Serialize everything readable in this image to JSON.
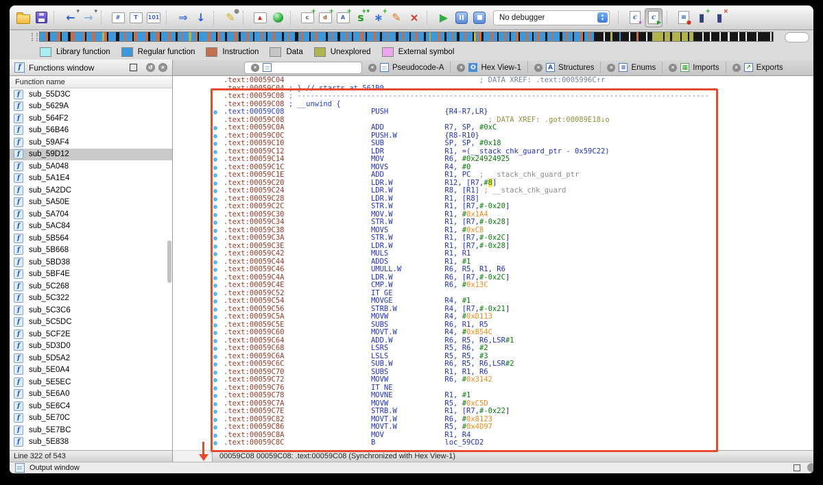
{
  "toolbar": {
    "debugger_label": "No debugger",
    "items": [
      {
        "n": "open-file-button",
        "k": "folder"
      },
      {
        "n": "save-file-button",
        "k": "floppy"
      },
      {
        "k": "sep"
      },
      {
        "n": "navigate-back-button",
        "k": "glyph",
        "g": "←",
        "c": "#2f5fd0",
        "b": "▾",
        "bc": "#666"
      },
      {
        "n": "navigate-forward-button",
        "k": "glyph",
        "g": "→",
        "c": "#8fb2e2",
        "b": "▾",
        "bc": "#666"
      },
      {
        "k": "sep"
      },
      {
        "n": "search-pattern-button",
        "k": "box",
        "g": "#",
        "c": "#3b62c8"
      },
      {
        "n": "search-text-button",
        "k": "box",
        "g": "T",
        "c": "#3b62c8"
      },
      {
        "n": "search-value-button",
        "k": "box",
        "g": "101",
        "c": "#3b62c8"
      },
      {
        "k": "sep"
      },
      {
        "n": "jump-button",
        "k": "glyph",
        "g": "⇒",
        "c": "#3b74d8"
      },
      {
        "n": "jump-next-button",
        "k": "glyph",
        "g": "↓",
        "c": "#2b62d0"
      },
      {
        "k": "sep"
      },
      {
        "n": "highlight-lock-button",
        "k": "glyph",
        "g": "✎",
        "c": "#d4b020",
        "b": "●",
        "bc": "#888"
      },
      {
        "k": "sep"
      },
      {
        "n": "problems-button",
        "k": "box",
        "g": "▲",
        "c": "#d93025"
      },
      {
        "n": "analysis-indicator",
        "k": "circle"
      },
      {
        "k": "sep"
      },
      {
        "n": "make-code-button",
        "k": "box",
        "g": "c",
        "c": "#555555",
        "b": "+",
        "bc": "#1f9f1f"
      },
      {
        "n": "make-data-button",
        "k": "box",
        "g": "d",
        "c": "#a0522d",
        "b": "+",
        "bc": "#1f9f1f"
      },
      {
        "n": "make-ascii-button",
        "k": "box",
        "g": "A",
        "c": "#3b62c8",
        "b": "+",
        "bc": "#1f9f1f"
      },
      {
        "n": "make-string-button",
        "k": "glyph",
        "g": "s",
        "c": "#1f9f1f",
        "b": "+▾",
        "bc": "#1f9f1f"
      },
      {
        "n": "make-array-button",
        "k": "glyph",
        "g": "∗",
        "c": "#3b74d8",
        "b": "+",
        "bc": "#1f9f1f"
      },
      {
        "n": "edit-button",
        "k": "glyph",
        "g": "✎",
        "c": "#e07820"
      },
      {
        "n": "undefine-button",
        "k": "glyph",
        "g": "×",
        "c": "#d43020"
      },
      {
        "k": "sep"
      },
      {
        "n": "start-process-button",
        "k": "glyph",
        "g": "▶",
        "c": "#2fae3f"
      },
      {
        "n": "pause-process-button",
        "k": "pause"
      },
      {
        "n": "stop-process-button",
        "k": "stop"
      },
      {
        "n": "debugger-select",
        "k": "combo"
      },
      {
        "k": "sep"
      },
      {
        "n": "compile-c-file-button",
        "k": "doc",
        "g": "c",
        "mark": "★",
        "mc": "#c050d0"
      },
      {
        "n": "pseudocode-button",
        "k": "doc",
        "g": "c",
        "mark": "▶",
        "mc": "#1f9f1f",
        "sel": true
      },
      {
        "k": "sep"
      },
      {
        "n": "notes-button",
        "k": "doc",
        "g": "≡",
        "mark": "●",
        "mc": "#d43020"
      },
      {
        "n": "add-breakpoint-button",
        "k": "glyph",
        "g": "▮",
        "c": "#35427e",
        "b": "+",
        "bc": "#1f9f1f"
      },
      {
        "n": "remove-breakpoint-button",
        "k": "glyph",
        "g": "▮",
        "c": "#35427e",
        "b": "×",
        "bc": "#d43020"
      }
    ]
  },
  "nav_band": {
    "marker_px": 633,
    "colors": {
      "K": "#161616",
      "B": "#3d97d8",
      "R": "#bf7150",
      "O": "#b2b24e",
      "G": "#c9c9c9",
      "W": "#f2f2f2"
    },
    "pattern": "8B 4R 3K 10B 5R 2K 9B 4K 6R 12B 3R 2K 8B 5R 10B 3O 4R 2K 11B 5K 7B 3R 9B 2K 5R 12B 4R 3K 8B 6R 2K 10B 4R 7B 3K 5B 2R 9B 4O 6B 3R 2K 12B 5R 8B 2K 4R 7B 3K 10B 5R 2B 3K 8B 4R 6B 2K 9B 3R 5B 2K 7B 4R 10B 3K 6B 2R 8B 5K 4B 3R 9B 2K 6B 4R 12B 3K 5B 2R 7B 4K 8B 3R 6B 2K 10B 5R 3B 2K 9B 4R 6B 3K 7B 2R 11B 4K 5B 3R 8B 2K 6B 4R 9B 3K 5B 2O 10B 4R 6B 3K 8B 2R 5B 4K 7B 3R 9B 2K 6B 5R 3K 10B 4R 6B 2K 8B 3R 5B 2K 7B 4R 2K 9B 3R 6B 2K 5B 4R 8B 3K 6B 2R 10B 4K 5B 3R 7B 2K 9B 4R 2K 6B 3R 5B 14K 2W 8K 3O 10K 2B 12K 2W 9K 3R 11K 2W 7K 16O 2K 8O 3K 12O 2K 9O 2K 6O 13K 2W 9K 2W 12K 2W 10K 3W 12K 2W 9K 2W 14K 2W 10K 8K 2W 4K"
  },
  "legend": {
    "items": [
      {
        "label": "Library function",
        "color": "#a8eef2"
      },
      {
        "label": "Regular function",
        "color": "#3d97d8"
      },
      {
        "label": "Instruction",
        "color": "#bf7150"
      },
      {
        "label": "Data",
        "color": "#c6c6c6"
      },
      {
        "label": "Unexplored",
        "color": "#b2b24e"
      },
      {
        "label": "External symbol",
        "color": "#eba6ec"
      }
    ]
  },
  "functions_panel": {
    "title": "Functions window",
    "column_header": "Function name",
    "status": "Line 322 of 543",
    "selected_index": 5,
    "items": [
      "sub_55D3C",
      "sub_5629A",
      "sub_564F2",
      "sub_56B46",
      "sub_59AF4",
      "sub_59D12",
      "sub_5A048",
      "sub_5A1E4",
      "sub_5A2DC",
      "sub_5A50E",
      "sub_5A704",
      "sub_5AC84",
      "sub_5B564",
      "sub_5B668",
      "sub_5BD38",
      "sub_5BF4E",
      "sub_5C268",
      "sub_5C322",
      "sub_5C3C6",
      "sub_5C5DC",
      "sub_5CF2E",
      "sub_5D3D0",
      "sub_5D5A2",
      "sub_5E0A4",
      "sub_5E5EC",
      "sub_5E6A0",
      "sub_5E6C4",
      "sub_5E70C",
      "sub_5E7BC",
      "sub_5E838"
    ]
  },
  "tabs": {
    "items": [
      {
        "name": "tab-ida-view",
        "label": "",
        "icon": "page",
        "active": true
      },
      {
        "name": "tab-pseudocode",
        "label": "Pseudocode-A",
        "icon": "page"
      },
      {
        "name": "tab-hex-view",
        "label": "Hex View-1",
        "icon": "hex",
        "glyph": "O"
      },
      {
        "name": "tab-structures",
        "label": "Structures",
        "icon": "struct",
        "glyph": "A"
      },
      {
        "name": "tab-enums",
        "label": "Enums",
        "icon": "enum",
        "glyph": "≡"
      },
      {
        "name": "tab-imports",
        "label": "Imports",
        "icon": "imp",
        "glyph": "▦"
      },
      {
        "name": "tab-exports",
        "label": "Exports",
        "icon": "exp",
        "glyph": "↗"
      }
    ]
  },
  "disassembly": {
    "status": "00059C08  00059C08: .text:00059C08  (Synchronized with Hex View-1)",
    "lines": [
      {
        "a": ".text:00059C04",
        "s": [
          [
            "                                             ",
            "p"
          ],
          [
            "; DATA XREF: .text:0005996C↑r",
            "xs"
          ]
        ]
      },
      {
        "a": ".text:00059C04",
        "s": [
          [
            " ; } // starts at 561B0",
            "c"
          ]
        ]
      },
      {
        "a": ".text:00059C08",
        "s": [
          [
            " ; -----------------------------------------------------------------------------------------------",
            "d"
          ]
        ]
      },
      {
        "a": ".text:00059C08",
        "s": [
          [
            " ; __unwind {",
            "c"
          ]
        ]
      },
      {
        "a": ".text:00059C08",
        "cur": true,
        "dot": true,
        "s": [
          [
            "                    PUSH             {R4-R7,LR}",
            "i"
          ]
        ]
      },
      {
        "a": ".text:00059C08",
        "s": [
          [
            "                                               ",
            "p"
          ],
          [
            "; DATA XREF: .got:00089E18↓o",
            "xo"
          ]
        ]
      },
      {
        "a": ".text:00059C0A",
        "dot": true,
        "s": [
          [
            "                    ADD              R7, SP, ",
            "i"
          ],
          [
            "#0xC",
            "g"
          ]
        ]
      },
      {
        "a": ".text:00059C0C",
        "dot": true,
        "s": [
          [
            "                    PUSH.W           {R8-R10}",
            "i"
          ]
        ]
      },
      {
        "a": ".text:00059C10",
        "dot": true,
        "s": [
          [
            "                    SUB              SP, SP, ",
            "i"
          ],
          [
            "#0x18",
            "g"
          ]
        ]
      },
      {
        "a": ".text:00059C12",
        "dot": true,
        "s": [
          [
            "                    LDR              R1, =(__stack_chk_guard_ptr - 0x59C22)",
            "i"
          ]
        ]
      },
      {
        "a": ".text:00059C14",
        "dot": true,
        "s": [
          [
            "                    MOV              R6, ",
            "i"
          ],
          [
            "#0x24924925",
            "g"
          ]
        ]
      },
      {
        "a": ".text:00059C1C",
        "dot": true,
        "s": [
          [
            "                    MOVS             R4, ",
            "i"
          ],
          [
            "#0",
            "g"
          ]
        ]
      },
      {
        "a": ".text:00059C1E",
        "dot": true,
        "s": [
          [
            "                    ADD              R1, PC  ",
            "i"
          ],
          [
            "; __stack_chk_guard_ptr",
            "n"
          ]
        ]
      },
      {
        "a": ".text:00059C20",
        "dot": true,
        "s": [
          [
            "                    LDR.W            R12, [R7,",
            "i"
          ],
          [
            "#",
            "g"
          ],
          [
            "8",
            "y"
          ],
          [
            "]",
            "i"
          ]
        ]
      },
      {
        "a": ".text:00059C24",
        "dot": true,
        "s": [
          [
            "                    LDR.W            R8, [R1] ",
            "i"
          ],
          [
            "; __stack_chk_guard",
            "n"
          ]
        ]
      },
      {
        "a": ".text:00059C28",
        "dot": true,
        "s": [
          [
            "                    LDR.W            R1, [R8]",
            "i"
          ]
        ]
      },
      {
        "a": ".text:00059C2C",
        "dot": true,
        "s": [
          [
            "                    STR.W            R1, [R7,",
            "i"
          ],
          [
            "#-0x20",
            "g"
          ],
          [
            "]",
            "i"
          ]
        ]
      },
      {
        "a": ".text:00059C30",
        "dot": true,
        "s": [
          [
            "                    MOV.W            R1, ",
            "i"
          ],
          [
            "#",
            "g"
          ],
          [
            "0x1A4",
            "o"
          ]
        ]
      },
      {
        "a": ".text:00059C34",
        "dot": true,
        "s": [
          [
            "                    STR.W            R1, [R7,",
            "i"
          ],
          [
            "#-0x28",
            "g"
          ],
          [
            "]",
            "i"
          ]
        ]
      },
      {
        "a": ".text:00059C38",
        "dot": true,
        "s": [
          [
            "                    MOVS             R1, ",
            "i"
          ],
          [
            "#",
            "g"
          ],
          [
            "0xC8",
            "o"
          ]
        ]
      },
      {
        "a": ".text:00059C3A",
        "dot": true,
        "s": [
          [
            "                    STR.W            R1, [R7,",
            "i"
          ],
          [
            "#-0x2C",
            "g"
          ],
          [
            "]",
            "i"
          ]
        ]
      },
      {
        "a": ".text:00059C3E",
        "dot": true,
        "s": [
          [
            "                    LDR.W            R1, [R7,",
            "i"
          ],
          [
            "#-0x28",
            "g"
          ],
          [
            "]",
            "i"
          ]
        ]
      },
      {
        "a": ".text:00059C42",
        "dot": true,
        "s": [
          [
            "                    MULS             R1, R1",
            "i"
          ]
        ]
      },
      {
        "a": ".text:00059C44",
        "dot": true,
        "s": [
          [
            "                    ADDS             R1, ",
            "i"
          ],
          [
            "#1",
            "g"
          ]
        ]
      },
      {
        "a": ".text:00059C46",
        "dot": true,
        "s": [
          [
            "                    UMULL.W          R6, R5, R1, R6",
            "i"
          ]
        ]
      },
      {
        "a": ".text:00059C4A",
        "dot": true,
        "s": [
          [
            "                    LDR.W            R6, [R7,",
            "i"
          ],
          [
            "#-0x2C",
            "g"
          ],
          [
            "]",
            "i"
          ]
        ]
      },
      {
        "a": ".text:00059C4E",
        "dot": true,
        "s": [
          [
            "                    CMP.W            R6, ",
            "i"
          ],
          [
            "#",
            "g"
          ],
          [
            "0x13C",
            "o"
          ]
        ]
      },
      {
        "a": ".text:00059C52",
        "dot": true,
        "s": [
          [
            "                    IT GE",
            "i"
          ]
        ]
      },
      {
        "a": ".text:00059C54",
        "dot": true,
        "s": [
          [
            "                    MOVGE            R4, ",
            "i"
          ],
          [
            "#1",
            "g"
          ]
        ]
      },
      {
        "a": ".text:00059C56",
        "dot": true,
        "s": [
          [
            "                    STRB.W           R4, [R7,",
            "i"
          ],
          [
            "#-0x21",
            "g"
          ],
          [
            "]",
            "i"
          ]
        ]
      },
      {
        "a": ".text:00059C5A",
        "dot": true,
        "s": [
          [
            "                    MOVW             R4, ",
            "i"
          ],
          [
            "#",
            "g"
          ],
          [
            "0xD113",
            "o"
          ]
        ]
      },
      {
        "a": ".text:00059C5E",
        "dot": true,
        "s": [
          [
            "                    SUBS             R6, R1, R5",
            "i"
          ]
        ]
      },
      {
        "a": ".text:00059C60",
        "dot": true,
        "s": [
          [
            "                    MOVT.W           R4, ",
            "i"
          ],
          [
            "#",
            "g"
          ],
          [
            "0xB54C",
            "o"
          ]
        ]
      },
      {
        "a": ".text:00059C64",
        "dot": true,
        "s": [
          [
            "                    ADD.W            R6, R5, R6,LSR",
            "i"
          ],
          [
            "#1",
            "g"
          ]
        ]
      },
      {
        "a": ".text:00059C68",
        "dot": true,
        "s": [
          [
            "                    LSRS             R5, R6, ",
            "i"
          ],
          [
            "#2",
            "g"
          ]
        ]
      },
      {
        "a": ".text:00059C6A",
        "dot": true,
        "s": [
          [
            "                    LSLS             R5, R5, ",
            "i"
          ],
          [
            "#3",
            "g"
          ]
        ]
      },
      {
        "a": ".text:00059C6C",
        "dot": true,
        "s": [
          [
            "                    SUB.W            R6, R5, R6,LSR",
            "i"
          ],
          [
            "#2",
            "g"
          ]
        ]
      },
      {
        "a": ".text:00059C70",
        "dot": true,
        "s": [
          [
            "                    SUBS             R1, R1, R6",
            "i"
          ]
        ]
      },
      {
        "a": ".text:00059C72",
        "dot": true,
        "s": [
          [
            "                    MOVW             R6, ",
            "i"
          ],
          [
            "#",
            "g"
          ],
          [
            "0x3142",
            "o"
          ]
        ]
      },
      {
        "a": ".text:00059C76",
        "dot": true,
        "s": [
          [
            "                    IT NE",
            "i"
          ]
        ]
      },
      {
        "a": ".text:00059C78",
        "dot": true,
        "s": [
          [
            "                    MOVNE            R1, ",
            "i"
          ],
          [
            "#1",
            "g"
          ]
        ]
      },
      {
        "a": ".text:00059C7A",
        "dot": true,
        "s": [
          [
            "                    MOVW             R5, ",
            "i"
          ],
          [
            "#",
            "g"
          ],
          [
            "0xC5D",
            "o"
          ]
        ]
      },
      {
        "a": ".text:00059C7E",
        "dot": true,
        "s": [
          [
            "                    STRB.W           R1, [R7,",
            "i"
          ],
          [
            "#-0x22",
            "g"
          ],
          [
            "]",
            "i"
          ]
        ]
      },
      {
        "a": ".text:00059C82",
        "dot": true,
        "s": [
          [
            "                    MOVT.W           R6, ",
            "i"
          ],
          [
            "#",
            "g"
          ],
          [
            "0x8123",
            "o"
          ]
        ]
      },
      {
        "a": ".text:00059C86",
        "dot": true,
        "s": [
          [
            "                    MOVT.W           R5, ",
            "i"
          ],
          [
            "#",
            "g"
          ],
          [
            "0x4D97",
            "o"
          ]
        ]
      },
      {
        "a": ".text:00059C8A",
        "dot": true,
        "s": [
          [
            "                    MOV              R1, R4",
            "i"
          ]
        ]
      },
      {
        "a": ".text:00059C8C",
        "dot": true,
        "s": [
          [
            "                    B                loc_59CD2",
            "i"
          ]
        ]
      }
    ]
  },
  "output_bar": {
    "label": "Output window"
  },
  "annotation": {
    "color": "#e8492c"
  }
}
